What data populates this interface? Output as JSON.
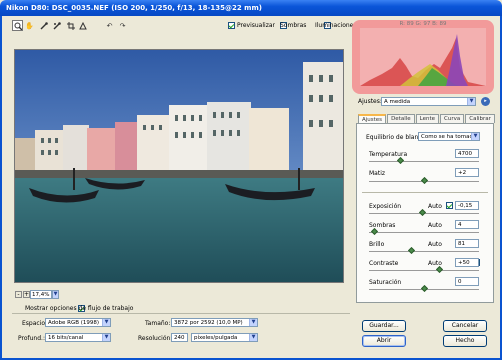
{
  "window": {
    "title": "Nikon D80:  DSC_0035.NEF   (ISO 200, 1/250, f/13, 18-135@22 mm)"
  },
  "toolbar": {
    "tools": [
      "zoom-icon",
      "hand-icon",
      "eyedropper-icon",
      "color-sampler-icon",
      "crop-icon",
      "straighten-icon",
      "rotate-left-icon",
      "rotate-right-icon"
    ],
    "previsualizar": "Previsualizar",
    "sombras": "Sombras",
    "iluminaciones": "Iluminaciones"
  },
  "histogram": {
    "rgb_readout": "R: 89   G: 97   B: 89"
  },
  "ajustes": {
    "label": "Ajustes:",
    "value": "A medida"
  },
  "tabs": [
    "Ajustes",
    "Detalle",
    "Lente",
    "Curva",
    "Calibrar"
  ],
  "controls": {
    "wb_label": "Equilibrio de blancos:",
    "wb_value": "Como se ha tomado",
    "temperatura_label": "Temperatura",
    "temperatura_value": "4700",
    "matiz_label": "Matiz",
    "matiz_value": "+2",
    "exposicion_label": "Exposición",
    "exposicion_value": "-0,15",
    "sombras_label": "Sombras",
    "sombras_value": "4",
    "brillo_label": "Brillo",
    "brillo_value": "81",
    "contraste_label": "Contraste",
    "contraste_value": "+50",
    "saturacion_label": "Saturación",
    "saturacion_value": "0",
    "auto": "Auto"
  },
  "zoom": {
    "value": "17,4%"
  },
  "workflow": {
    "mostrar": "Mostrar opciones de flujo de trabajo",
    "espacio_label": "Espacio:",
    "espacio_value": "Adobe RGB (1998)",
    "profund_label": "Profund.:",
    "profund_value": "16 bits/canal",
    "tamano_label": "Tamaño:",
    "tamano_value": "3872 por 2592  (10,0 MP)",
    "resolucion_label": "Resolución:",
    "resolucion_value": "240",
    "resolucion_unit": "píxeles/pulgada"
  },
  "buttons": {
    "guardar": "Guardar...",
    "cancelar": "Cancelar",
    "abrir": "Abrir",
    "hecho": "Hecho"
  }
}
